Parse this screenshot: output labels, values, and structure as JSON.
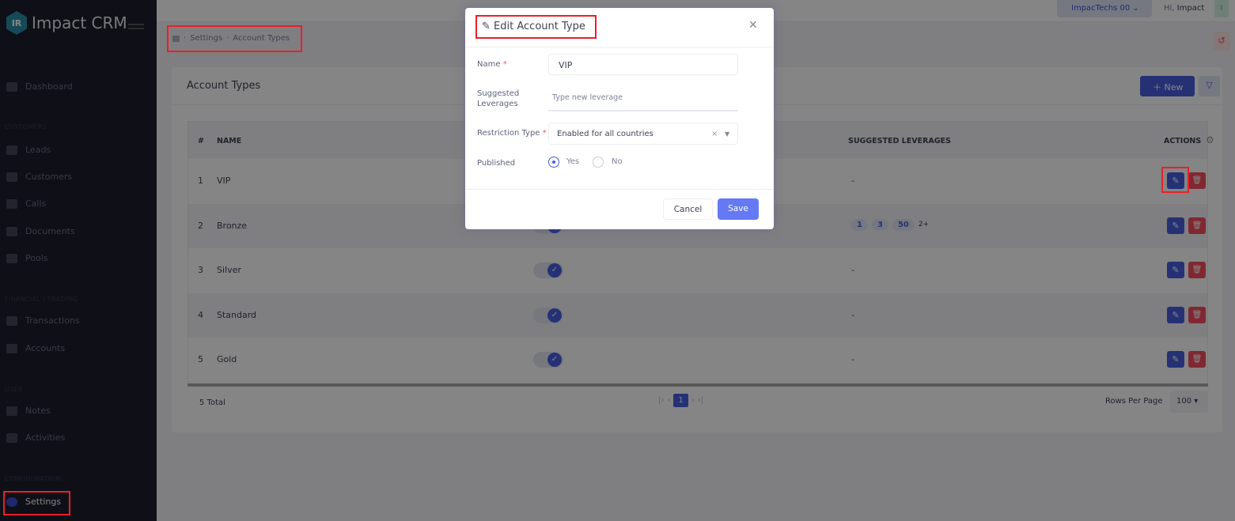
{
  "app": {
    "name": "Impact CRM",
    "logo_letters": "IR"
  },
  "sidebar": {
    "top_item": "Dashboard",
    "sections": [
      {
        "title": "CUSTOMERS",
        "items": [
          "Leads",
          "Customers",
          "Calls",
          "Documents",
          "Pools"
        ]
      },
      {
        "title": "FINANCIAL / TRADING",
        "items": [
          "Transactions",
          "Accounts"
        ]
      },
      {
        "title": "USER",
        "items": [
          "Notes",
          "Activities"
        ]
      },
      {
        "title": "CONFIGURATION",
        "items": [
          "Settings"
        ]
      }
    ],
    "active": "Settings"
  },
  "header": {
    "account": "ImpacTechs 00",
    "greeting": "Hi,",
    "user": "Impact",
    "user_initial": "I"
  },
  "breadcrumb": [
    "Settings",
    "Account Types"
  ],
  "card": {
    "title": "Account Types",
    "new_label": "New"
  },
  "table": {
    "columns": [
      "#",
      "NAME",
      "SUGGESTED LEVERAGES",
      "ACTIONS"
    ],
    "rows": [
      {
        "n": "1",
        "name": "VIP",
        "published": true,
        "leverages": "-"
      },
      {
        "n": "2",
        "name": "Bronze",
        "published": true,
        "leverages": [
          "1",
          "3",
          "50"
        ],
        "more": "2+"
      },
      {
        "n": "3",
        "name": "Silver",
        "published": true,
        "leverages": "-"
      },
      {
        "n": "4",
        "name": "Standard",
        "published": true,
        "leverages": "-"
      },
      {
        "n": "5",
        "name": "Gold",
        "published": true,
        "leverages": "-"
      }
    ]
  },
  "footer": {
    "total": "5 Total",
    "page": "1",
    "rows_per_page_label": "Rows Per Page",
    "rows_per_page": "100"
  },
  "modal": {
    "title": "Edit Account Type",
    "name_label": "Name",
    "name_value": "VIP",
    "leverages_label": "Suggested Leverages",
    "leverages_placeholder": "Type new leverage",
    "restriction_label": "Restriction Type",
    "restriction_value": "Enabled for all countries",
    "published_label": "Published",
    "yes": "Yes",
    "no": "No",
    "published": "Yes",
    "cancel": "Cancel",
    "save": "Save"
  },
  "colors": {
    "primary": "#4a5fe0",
    "danger": "#f64e60",
    "highlight": "#e8202a"
  }
}
